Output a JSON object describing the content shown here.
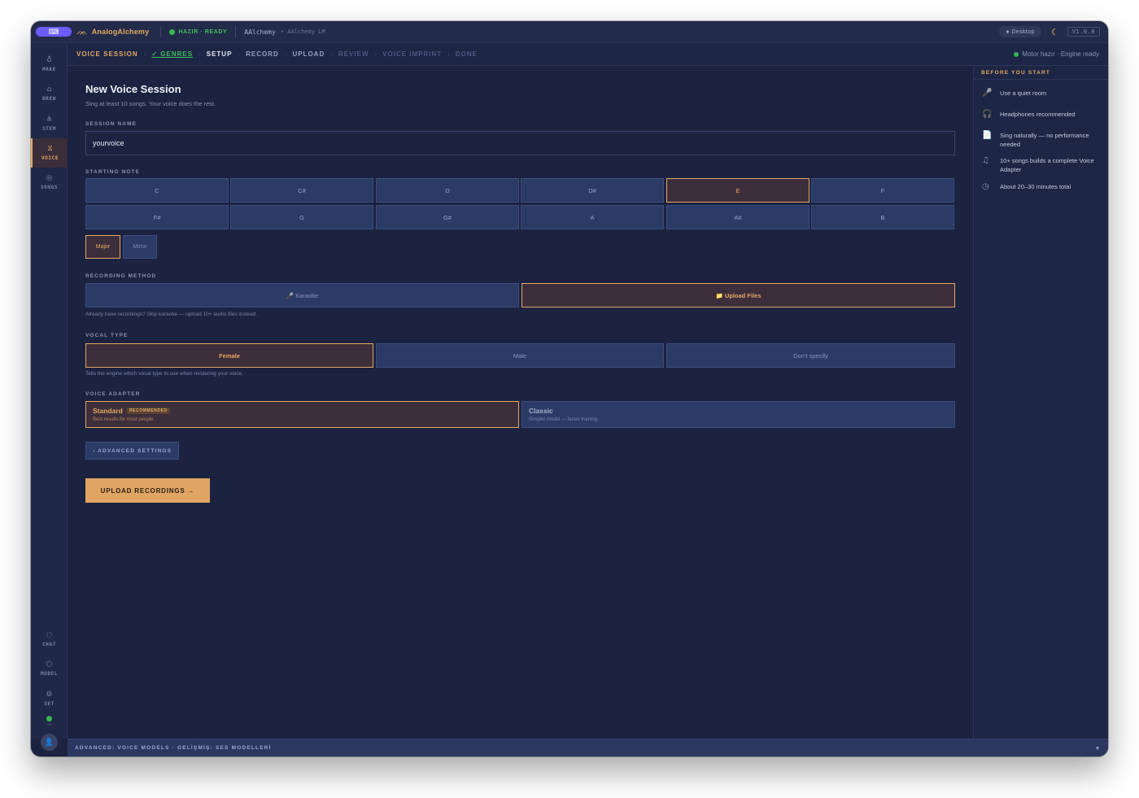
{
  "titlebar": {
    "logo_glyph": "⌨",
    "app_mark": "ᨏ",
    "app_name": "AnalogAlchemy",
    "status": "HAZIR · READY",
    "project": "AAlchemy",
    "project_sub": "• AAlchemy LM",
    "desktop": "● Desktop",
    "theme_icon": "☾",
    "version": "V1.0.0"
  },
  "sidebar": {
    "items": [
      {
        "icon": "♁",
        "label": "MAKE"
      },
      {
        "icon": "⌂",
        "label": "BREW"
      },
      {
        "icon": "⋔",
        "label": "STEM"
      },
      {
        "icon": "⧖",
        "label": "VOICE"
      },
      {
        "icon": "◎",
        "label": "SONGS"
      }
    ],
    "bottom_items": [
      {
        "icon": "◌",
        "label": "CHAT"
      },
      {
        "icon": "⬡",
        "label": "MODEL"
      },
      {
        "icon": "⚙",
        "label": "SET"
      }
    ],
    "status_label": "ON",
    "avatar_icon": "👤"
  },
  "crumbs": {
    "session": "VOICE SESSION",
    "steps": [
      "✓ GENRES",
      "SETUP",
      "RECORD",
      "UPLOAD",
      "REVIEW",
      "VOICE IMPRINT",
      "DONE"
    ],
    "separator": "›",
    "engine": "Motor hazır · Engine ready"
  },
  "main": {
    "title": "New Voice Session",
    "subtitle": "Sing at least 10 songs. Your voice does the rest.",
    "session_name_label": "SESSION NAME",
    "session_name_value": "yourvoice",
    "starting_note_label": "STARTING NOTE",
    "notes": [
      "C",
      "C#",
      "D",
      "D#",
      "E",
      "F",
      "F#",
      "G",
      "G#",
      "A",
      "A#",
      "B"
    ],
    "selected_note": "E",
    "modes": [
      "Major",
      "Minor"
    ],
    "selected_mode": "Major",
    "recording_method_label": "RECORDING METHOD",
    "methods": [
      "🎤 Karaoke",
      "📁 Upload Files"
    ],
    "selected_method": "📁 Upload Files",
    "method_hint": "Already have recordings? Skip karaoke — upload 10+ audio files instead.",
    "vocal_type_label": "VOCAL TYPE",
    "vocal_types": [
      "Female",
      "Male",
      "Don't specify"
    ],
    "selected_vocal_type": "Female",
    "vocal_hint": "Tells the engine which vocal type to use when rendering your voice.",
    "voice_adapter_label": "VOICE ADAPTER",
    "adapters": [
      {
        "title": "Standard",
        "badge": "RECOMMENDED",
        "desc": "Best results for most people."
      },
      {
        "title": "Classic",
        "badge": "",
        "desc": "Simpler model — faster training."
      }
    ],
    "selected_adapter": "Standard",
    "advanced_label": "› ADVANCED SETTINGS",
    "cta_label": "UPLOAD RECORDINGS →"
  },
  "right_panel": {
    "title": "BEFORE YOU START",
    "tips": [
      {
        "icon": "🎤",
        "text": "Use a quiet room"
      },
      {
        "icon": "🎧",
        "text": "Headphones recommended"
      },
      {
        "icon": "📄",
        "text": "Sing naturally — no performance needed"
      },
      {
        "icon": "♫",
        "text": "10+ songs builds a complete Voice Adapter"
      },
      {
        "icon": "◷",
        "text": "About 20–30 minutes total"
      }
    ]
  },
  "bottombar": {
    "label": "ADVANCED: VOICE MODELS · GELİŞMİŞ: SES MODELLERİ",
    "chevron": "▾"
  },
  "colors": {
    "accent": "#e3a860",
    "ready_green": "#3fbf5c",
    "background": "#1b2340"
  }
}
